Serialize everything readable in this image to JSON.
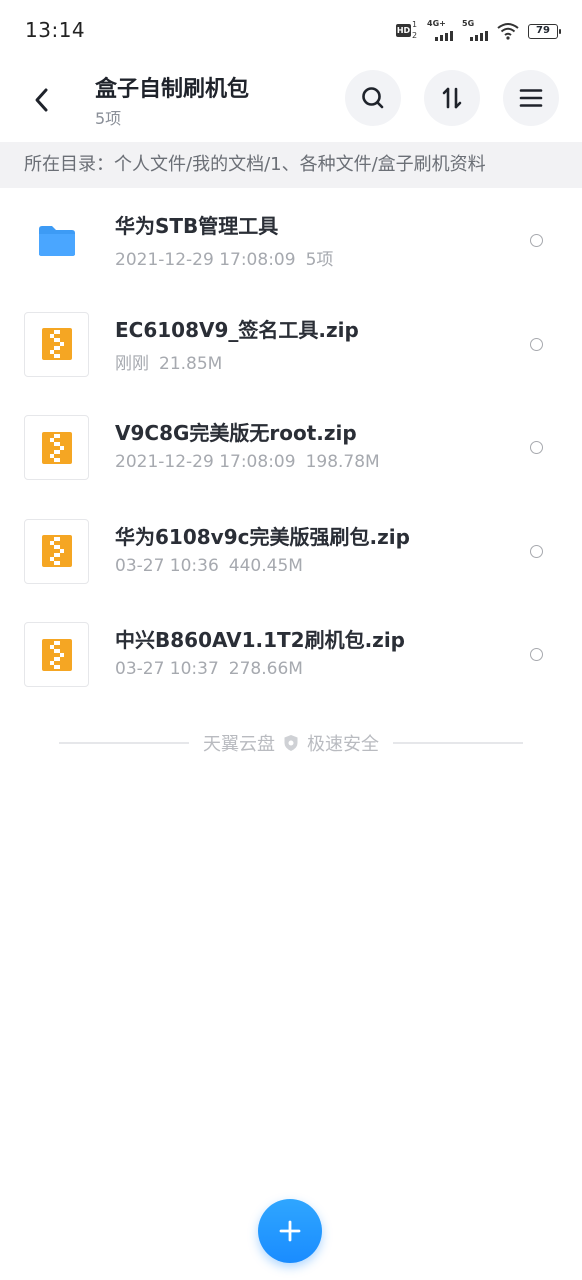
{
  "status_bar": {
    "time": "13:14",
    "hd_label": "HD",
    "hd_sup": "1",
    "hd_sub": "2",
    "signal_1": "4G+",
    "signal_2": "5G",
    "battery": "79"
  },
  "header": {
    "title": "盒子自制刷机包",
    "subtitle": "5项",
    "buttons": [
      "search-icon",
      "sort-icon",
      "menu-icon"
    ]
  },
  "path_bar": {
    "text": "所在目录：个人文件/我的文档/1、各种文件/盒子刷机资料"
  },
  "files": [
    {
      "name": "华为STB管理工具",
      "date": "2021-12-29 17:08:09",
      "size": "5项",
      "type": "folder"
    },
    {
      "name": "EC6108V9_签名工具.zip",
      "date": "刚刚",
      "size": "21.85M",
      "type": "zip"
    },
    {
      "name": "V9C8G完美版无root.zip",
      "date": "2021-12-29 17:08:09",
      "size": "198.78M",
      "type": "zip"
    },
    {
      "name": "华为6108v9c完美版强刷包.zip",
      "date": "03-27 10:36",
      "size": "440.45M",
      "type": "zip"
    },
    {
      "name": "中兴B860AV1.1T2刷机包.zip",
      "date": "03-27 10:37",
      "size": "278.66M",
      "type": "zip"
    }
  ],
  "footer": {
    "brand": "天翼云盘",
    "tagline": "极速安全"
  },
  "colors": {
    "accent": "#1a8cff",
    "folder": "#3d9bf5",
    "zip": "#f5a623"
  }
}
